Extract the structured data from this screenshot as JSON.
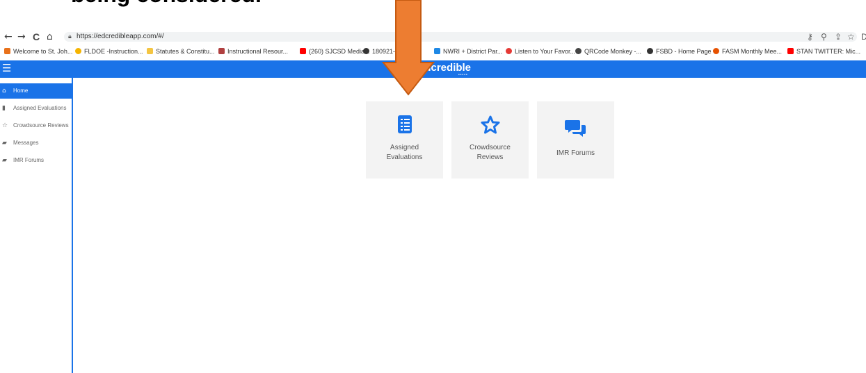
{
  "slide": {
    "title": "being considered."
  },
  "browser": {
    "nav": {
      "back": "←",
      "forward": "→",
      "reload": "C",
      "home": "⌂"
    },
    "url": "https://edcredibleapp.com/#/",
    "right_icons": [
      "key-icon",
      "zoom-icon",
      "share-icon",
      "star-icon"
    ]
  },
  "bookmarks": [
    {
      "label": "Welcome to St. Joh...",
      "color": "#e8711a"
    },
    {
      "label": "FLDOE -Instruction...",
      "color": "#f5b400"
    },
    {
      "label": "Statutes & Constitu...",
      "color": "#f4c542"
    },
    {
      "label": "Instructional Resour...",
      "color": "#b04040"
    },
    {
      "label": "(260) SJCSD Media...",
      "color": "#ff0000"
    },
    {
      "label": "180921-a",
      "color": "#333333"
    },
    {
      "label": "NWRI + District Par...",
      "color": "#1e88e5"
    },
    {
      "label": "Listen to Your Favor...",
      "color": "#e53935"
    },
    {
      "label": "QRCode Monkey -...",
      "color": "#444444"
    },
    {
      "label": "FSBD - Home Page",
      "color": "#333333"
    },
    {
      "label": "FASM Monthly Mee...",
      "color": "#e65100"
    },
    {
      "label": "STAN TWITTER: Mic...",
      "color": "#ff0000"
    }
  ],
  "app": {
    "logo": "edcredible",
    "logo_dots": "•••••",
    "brand_color": "#1a73e8"
  },
  "sidebar": {
    "items": [
      {
        "label": "Home",
        "icon": "home-icon",
        "active": true
      },
      {
        "label": "Assigned Evaluations",
        "icon": "clipboard-icon",
        "active": false
      },
      {
        "label": "Crowdsource Reviews",
        "icon": "star-icon",
        "active": false
      },
      {
        "label": "Messages",
        "icon": "chat-icon",
        "active": false
      },
      {
        "label": "IMR Forums",
        "icon": "forum-icon",
        "active": false
      }
    ]
  },
  "cards": [
    {
      "label_line1": "Assigned",
      "label_line2": "Evaluations",
      "icon": "checklist-icon"
    },
    {
      "label_line1": "Crowdsource",
      "label_line2": "Reviews",
      "icon": "star-outline-icon"
    },
    {
      "label_line1": "IMR Forums",
      "label_line2": "",
      "icon": "chat-bubbles-icon"
    }
  ],
  "annotation": {
    "arrow_color": "#ed7d31",
    "arrow_border": "#c55a11"
  }
}
